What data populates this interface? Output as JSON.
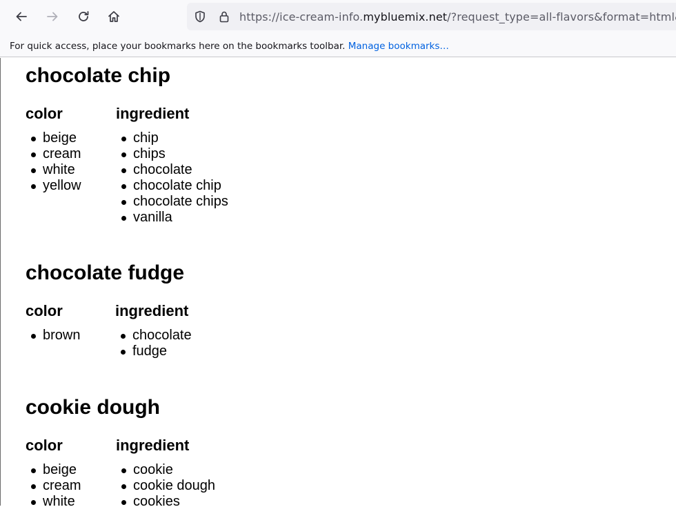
{
  "browser": {
    "url_prefix": "https://ice-cream-info.",
    "url_host": "mybluemix.net",
    "url_suffix": "/?request_type=all-flavors&format=html&tok",
    "bookmarks_message": "For quick access, place your bookmarks here on the bookmarks toolbar.",
    "bookmarks_link": "Manage bookmarks…"
  },
  "flavors": [
    {
      "name": "chocolate chip",
      "color_heading": "color",
      "ingredient_heading": "ingredient",
      "colors": [
        "beige",
        "cream",
        "white",
        "yellow"
      ],
      "ingredients": [
        "chip",
        "chips",
        "chocolate",
        "chocolate chip",
        "chocolate chips",
        "vanilla"
      ]
    },
    {
      "name": "chocolate fudge",
      "color_heading": "color",
      "ingredient_heading": "ingredient",
      "colors": [
        "brown"
      ],
      "ingredients": [
        "chocolate",
        "fudge"
      ]
    },
    {
      "name": "cookie dough",
      "color_heading": "color",
      "ingredient_heading": "ingredient",
      "colors": [
        "beige",
        "cream",
        "white"
      ],
      "ingredients": [
        "cookie",
        "cookie dough",
        "cookies"
      ]
    }
  ]
}
